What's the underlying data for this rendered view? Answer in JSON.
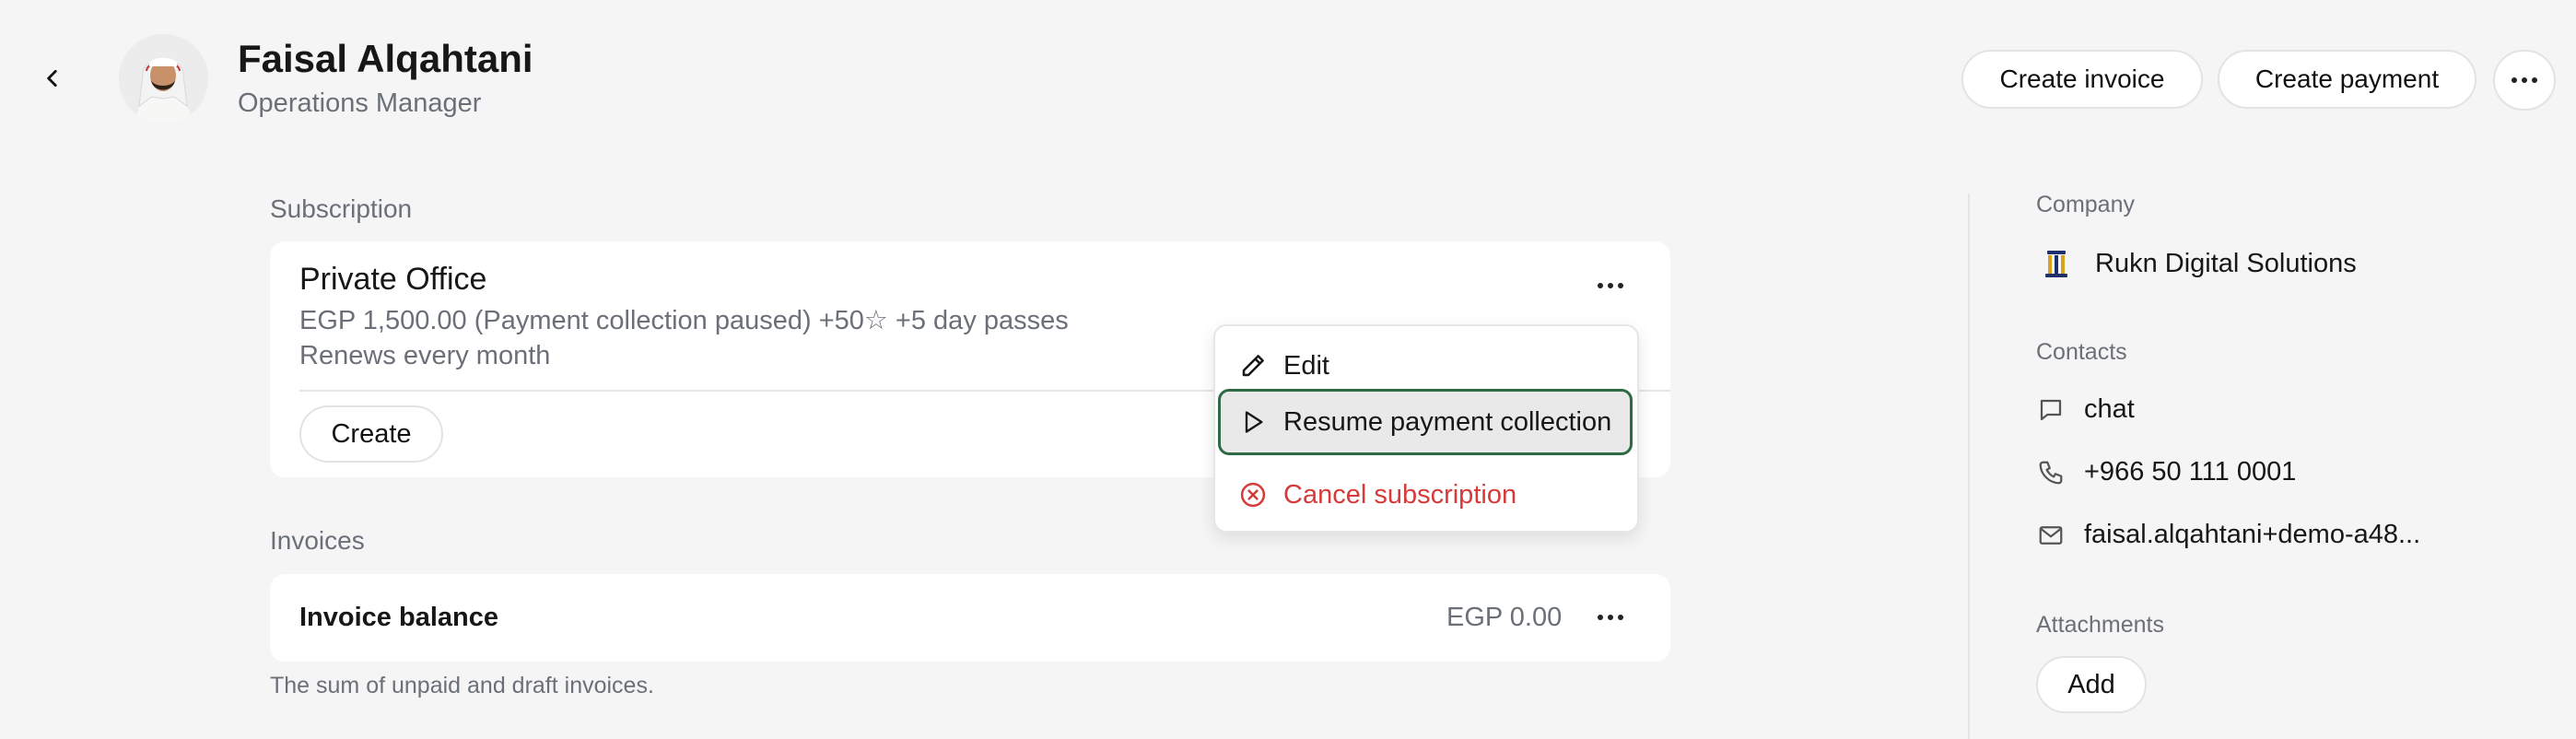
{
  "header": {
    "back_icon": "chevron-left-icon",
    "person_name": "Faisal Alqahtani",
    "person_role": "Operations Manager",
    "actions": {
      "create_invoice": "Create invoice",
      "create_payment": "Create payment",
      "more_icon": "more-horizontal-icon"
    }
  },
  "subscription": {
    "section_label": "Subscription",
    "plan_name": "Private Office",
    "price_line": "EGP 1,500.00 (Payment collection paused) +50☆ +5 day passes",
    "renew_line": "Renews every month",
    "create_label": "Create",
    "menu": {
      "edit": "Edit",
      "resume": "Resume payment collection",
      "cancel": "Cancel subscription"
    }
  },
  "invoices": {
    "section_label": "Invoices",
    "balance_title": "Invoice balance",
    "balance_amount": "EGP 0.00",
    "note": "The sum of unpaid and draft invoices."
  },
  "sidebar": {
    "company_label": "Company",
    "company_name": "Rukn Digital Solutions",
    "contacts_label": "Contacts",
    "contacts": {
      "chat": "chat",
      "phone": "+966 50 111 0001",
      "email": "faisal.alqahtani+demo-a48..."
    },
    "attachments_label": "Attachments",
    "add_label": "Add"
  },
  "colors": {
    "background": "#f5f5f5",
    "card": "#ffffff",
    "muted_text": "#6b7078",
    "danger": "#d63a3a",
    "focus_ring": "#2e6b45"
  }
}
